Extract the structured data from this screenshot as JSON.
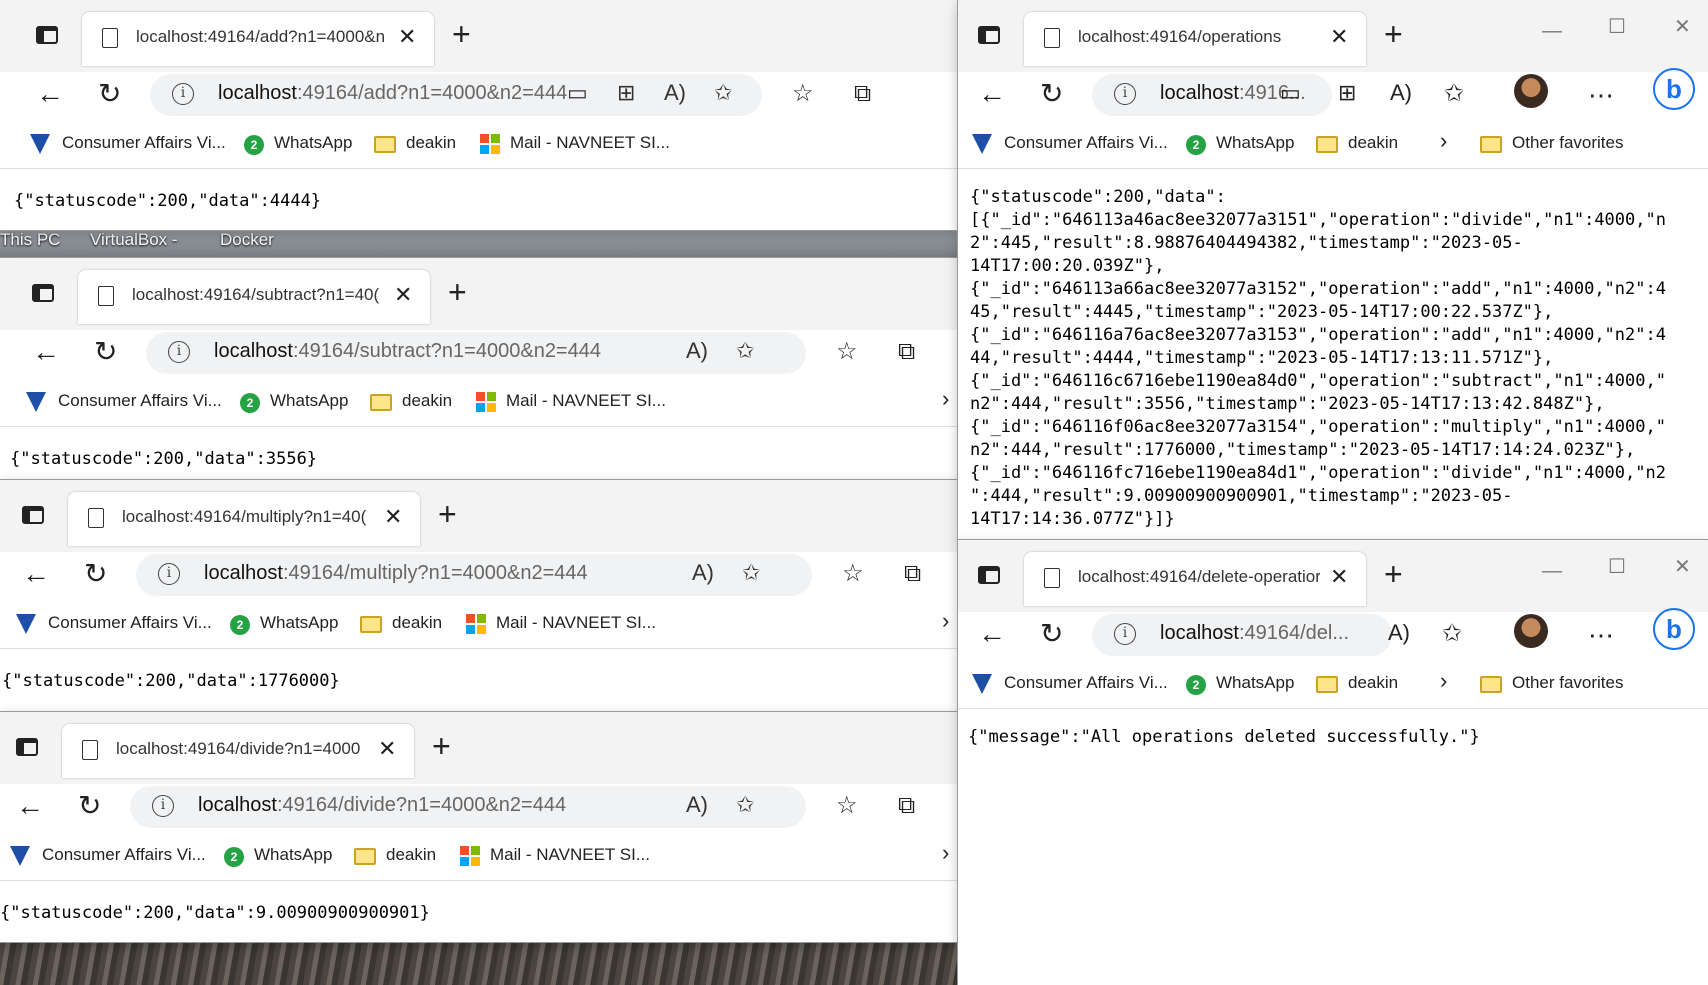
{
  "desktop": {
    "icons": [
      "This PC",
      "VirtualBox -",
      "Docker"
    ]
  },
  "common": {
    "bookmarks": [
      "Consumer Affairs Vi...",
      "WhatsApp",
      "deakin",
      "Mail - NAVNEET SI..."
    ],
    "other_favorites": "Other favorites",
    "colors": {
      "url_rest": "#666666",
      "edge_blue": "#1a73e8"
    }
  },
  "windows": {
    "add": {
      "tab_title": "localhost:49164/add?n1=4000&n",
      "url_host": "localhost",
      "url_rest": ":49164/add?n1=4000&n2=444",
      "body": "{\"statuscode\":200,\"data\":4444}"
    },
    "subtract": {
      "tab_title": "localhost:49164/subtract?n1=40(",
      "url_host": "localhost",
      "url_rest": ":49164/subtract?n1=4000&n2=444",
      "body": "{\"statuscode\":200,\"data\":3556}"
    },
    "multiply": {
      "tab_title": "localhost:49164/multiply?n1=40(",
      "url_host": "localhost",
      "url_rest": ":49164/multiply?n1=4000&n2=444",
      "body": "{\"statuscode\":200,\"data\":1776000}"
    },
    "divide": {
      "tab_title": "localhost:49164/divide?n1=4000",
      "url_host": "localhost",
      "url_rest": ":49164/divide?n1=4000&n2=444",
      "body": "{\"statuscode\":200,\"data\":9.00900900900901}"
    },
    "operations": {
      "tab_title": "localhost:49164/operations",
      "url_host": "localhost",
      "url_rest": ":4916...",
      "body_lines": [
        "{\"statuscode\":200,\"data\":",
        "[{\"_id\":\"646113a46ac8ee32077a3151\",\"operation\":\"divide\",\"n1\":4000,\"n",
        "2\":445,\"result\":8.98876404494382,\"timestamp\":\"2023-05-",
        "14T17:00:20.039Z\"},",
        "{\"_id\":\"646113a66ac8ee32077a3152\",\"operation\":\"add\",\"n1\":4000,\"n2\":4",
        "45,\"result\":4445,\"timestamp\":\"2023-05-14T17:00:22.537Z\"},",
        "{\"_id\":\"646116a76ac8ee32077a3153\",\"operation\":\"add\",\"n1\":4000,\"n2\":4",
        "44,\"result\":4444,\"timestamp\":\"2023-05-14T17:13:11.571Z\"},",
        "{\"_id\":\"646116c6716ebe1190ea84d0\",\"operation\":\"subtract\",\"n1\":4000,\"",
        "n2\":444,\"result\":3556,\"timestamp\":\"2023-05-14T17:13:42.848Z\"},",
        "{\"_id\":\"646116f06ac8ee32077a3154\",\"operation\":\"multiply\",\"n1\":4000,\"",
        "n2\":444,\"result\":1776000,\"timestamp\":\"2023-05-14T17:14:24.023Z\"},",
        "{\"_id\":\"646116fc716ebe1190ea84d1\",\"operation\":\"divide\",\"n1\":4000,\"n2",
        "\":444,\"result\":9.00900900900901,\"timestamp\":\"2023-05-",
        "14T17:14:36.077Z\"}]}"
      ]
    },
    "delete": {
      "tab_title": "localhost:49164/delete-operatior",
      "url_host": "localhost",
      "url_rest": ":49164/del...",
      "body": "{\"message\":\"All operations deleted successfully.\"}"
    }
  }
}
